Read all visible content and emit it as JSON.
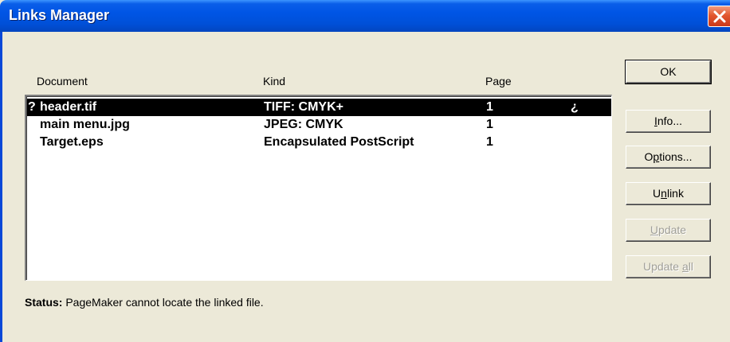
{
  "window": {
    "title": "Links Manager"
  },
  "columns": {
    "document": "Document",
    "kind": "Kind",
    "page": "Page"
  },
  "rows": [
    {
      "flag": "?",
      "document": "header.tif",
      "kind": "TIFF: CMYK+",
      "page": "1",
      "status_mark": "¿",
      "selected": true
    },
    {
      "flag": "",
      "document": "main menu.jpg",
      "kind": "JPEG: CMYK",
      "page": "1",
      "status_mark": "",
      "selected": false
    },
    {
      "flag": "",
      "document": "Target.eps",
      "kind": "Encapsulated PostScript",
      "page": "1",
      "status_mark": "",
      "selected": false
    }
  ],
  "buttons": {
    "ok": {
      "label": "OK"
    },
    "info": {
      "mnemonic": "I",
      "rest": "nfo..."
    },
    "options": {
      "pre": "O",
      "mnemonic": "p",
      "rest": "tions..."
    },
    "unlink": {
      "pre": "U",
      "mnemonic": "n",
      "rest": "link"
    },
    "update": {
      "mnemonic": "U",
      "rest": "pdate"
    },
    "update_all": {
      "pre": "Update ",
      "mnemonic": "a",
      "rest": "ll"
    }
  },
  "status": {
    "label": "Status:",
    "message": "PageMaker cannot locate the linked file."
  },
  "colors": {
    "titlebar": "#0055e5",
    "close_button": "#e2572f",
    "dialog_bg": "#ece9d8",
    "selection_bg": "#000000"
  }
}
